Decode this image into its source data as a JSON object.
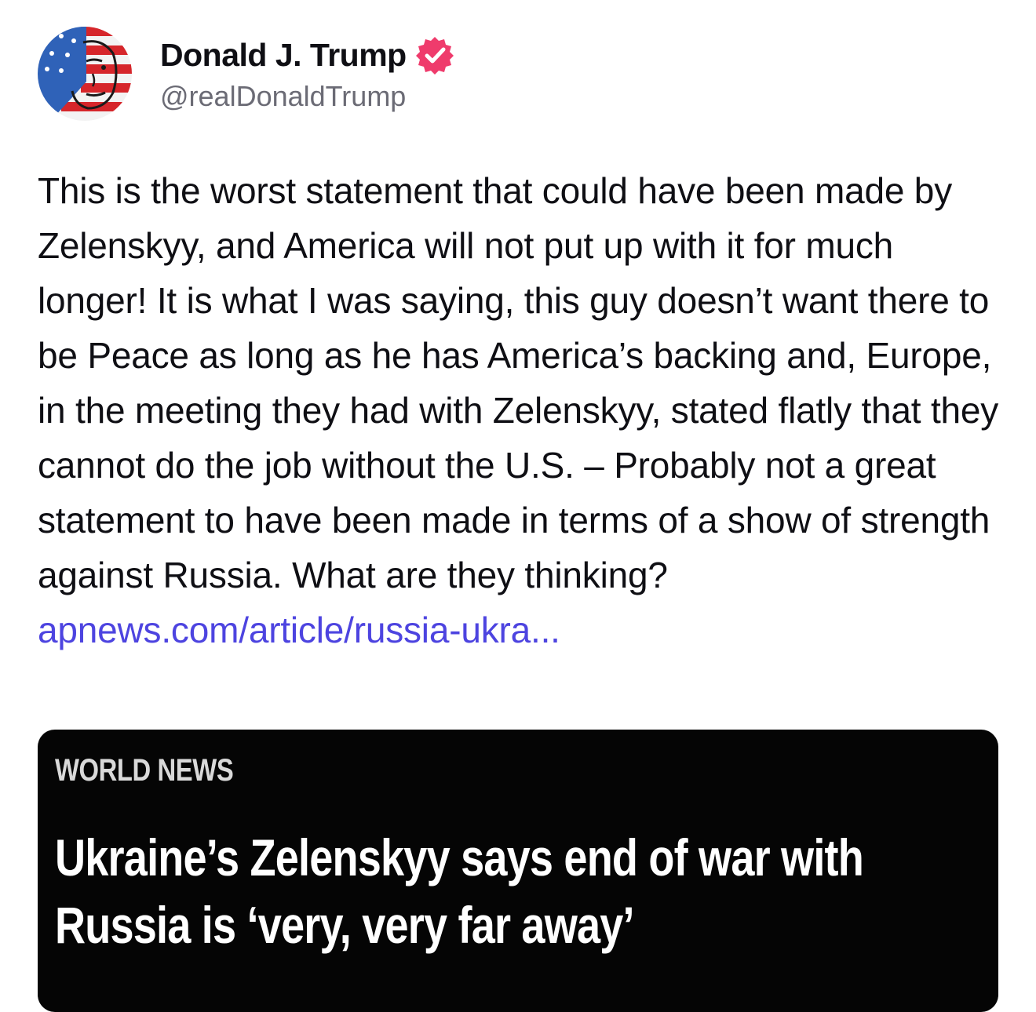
{
  "author": {
    "display_name": "Donald J. Trump",
    "handle": "@realDonaldTrump",
    "verified_color": "#ef3b6c",
    "avatar_icon": "flag-portrait-avatar"
  },
  "post": {
    "text": "This is the worst statement that could have been made by Zelenskyy, and America will not put up with it for much longer! It is what I was saying, this guy doesn’t want there to be Peace as long as he has America’s backing and, Europe, in the meeting they had with Zelenskyy, stated flatly that they cannot do the job without the U.S. – Probably not a great statement to have been made in terms of a show of strength against Russia. What are they thinking?",
    "link_text": "apnews.com/article/russia-ukra...",
    "link_color": "#4d44e0"
  },
  "preview": {
    "section": "WORLD NEWS",
    "headline": "Ukraine’s Zelenskyy says end of war with Russia is ‘very, very far away’"
  }
}
